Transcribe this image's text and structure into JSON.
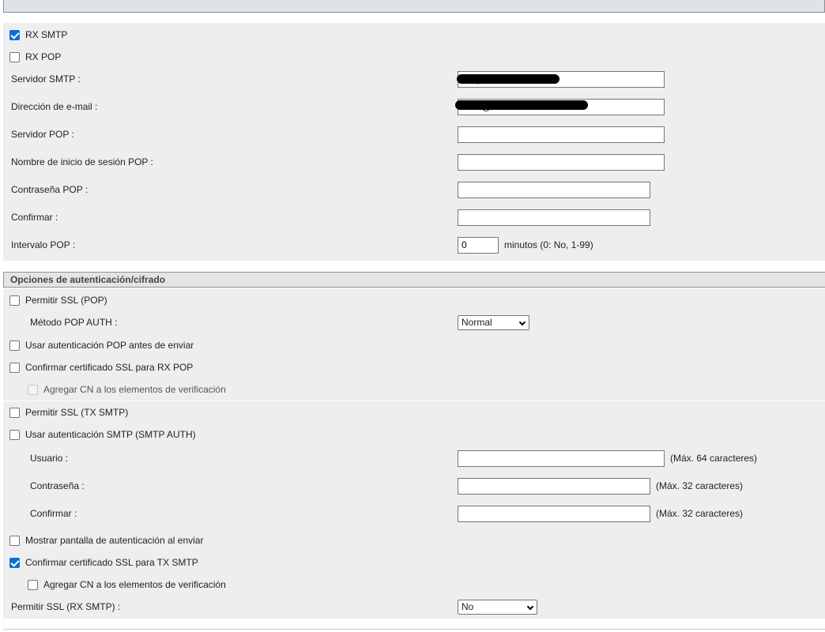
{
  "server_section": {
    "rx_smtp": {
      "label": "RX SMTP",
      "checked": true
    },
    "rx_pop": {
      "label": "RX POP",
      "checked": false
    },
    "smtp_server": {
      "label": "Servidor SMTP :",
      "value": "smtp.••••••u"
    },
    "email_address": {
      "label": "Dirección de e-mail :",
      "value": "••••••@••••••"
    },
    "pop_server": {
      "label": "Servidor POP :",
      "value": ""
    },
    "pop_login": {
      "label": "Nombre de inicio de sesión POP :",
      "value": ""
    },
    "pop_password": {
      "label": "Contraseña POP :",
      "value": ""
    },
    "confirm": {
      "label": "Confirmar :",
      "value": ""
    },
    "pop_interval": {
      "label": "Intervalo POP :",
      "value": "0",
      "hint": "minutos (0: No, 1-99)"
    }
  },
  "auth_section": {
    "title": "Opciones de autenticación/cifrado",
    "allow_ssl_pop": {
      "label": "Permitir SSL (POP)",
      "checked": false
    },
    "pop_auth_method": {
      "label": "Método POP AUTH :",
      "selected": "Normal"
    },
    "pop_before_send": {
      "label": "Usar autenticación POP antes de enviar",
      "checked": false
    },
    "confirm_ssl_rx_pop": {
      "label": "Confirmar certificado SSL para RX POP",
      "checked": false
    },
    "add_cn_pop": {
      "label": "Agregar CN a los elementos de verificación",
      "checked": false,
      "disabled": true
    },
    "allow_ssl_tx_smtp": {
      "label": "Permitir SSL (TX SMTP)",
      "checked": false
    },
    "smtp_auth": {
      "label": "Usar autenticación SMTP (SMTP AUTH)",
      "checked": false
    },
    "user": {
      "label": "Usuario :",
      "value": "",
      "hint": "(Máx. 64 caracteres)"
    },
    "password": {
      "label": "Contraseña :",
      "value": "",
      "hint": "(Máx. 32 caracteres)"
    },
    "confirm": {
      "label": "Confirmar :",
      "value": "",
      "hint": "(Máx. 32 caracteres)"
    },
    "show_auth_screen": {
      "label": "Mostrar pantalla de autenticación al enviar",
      "checked": false
    },
    "confirm_ssl_tx_smtp": {
      "label": "Confirmar certificado SSL para TX SMTP",
      "checked": true
    },
    "add_cn_smtp": {
      "label": "Agregar CN a los elementos de verificación",
      "checked": false
    },
    "allow_ssl_rx_smtp": {
      "label": "Permitir SSL (RX SMTP) :",
      "selected": "No"
    }
  },
  "colors": {
    "accent": "#0b6fd6",
    "panel": "#eeeeee",
    "header": "#e4e4e4"
  }
}
